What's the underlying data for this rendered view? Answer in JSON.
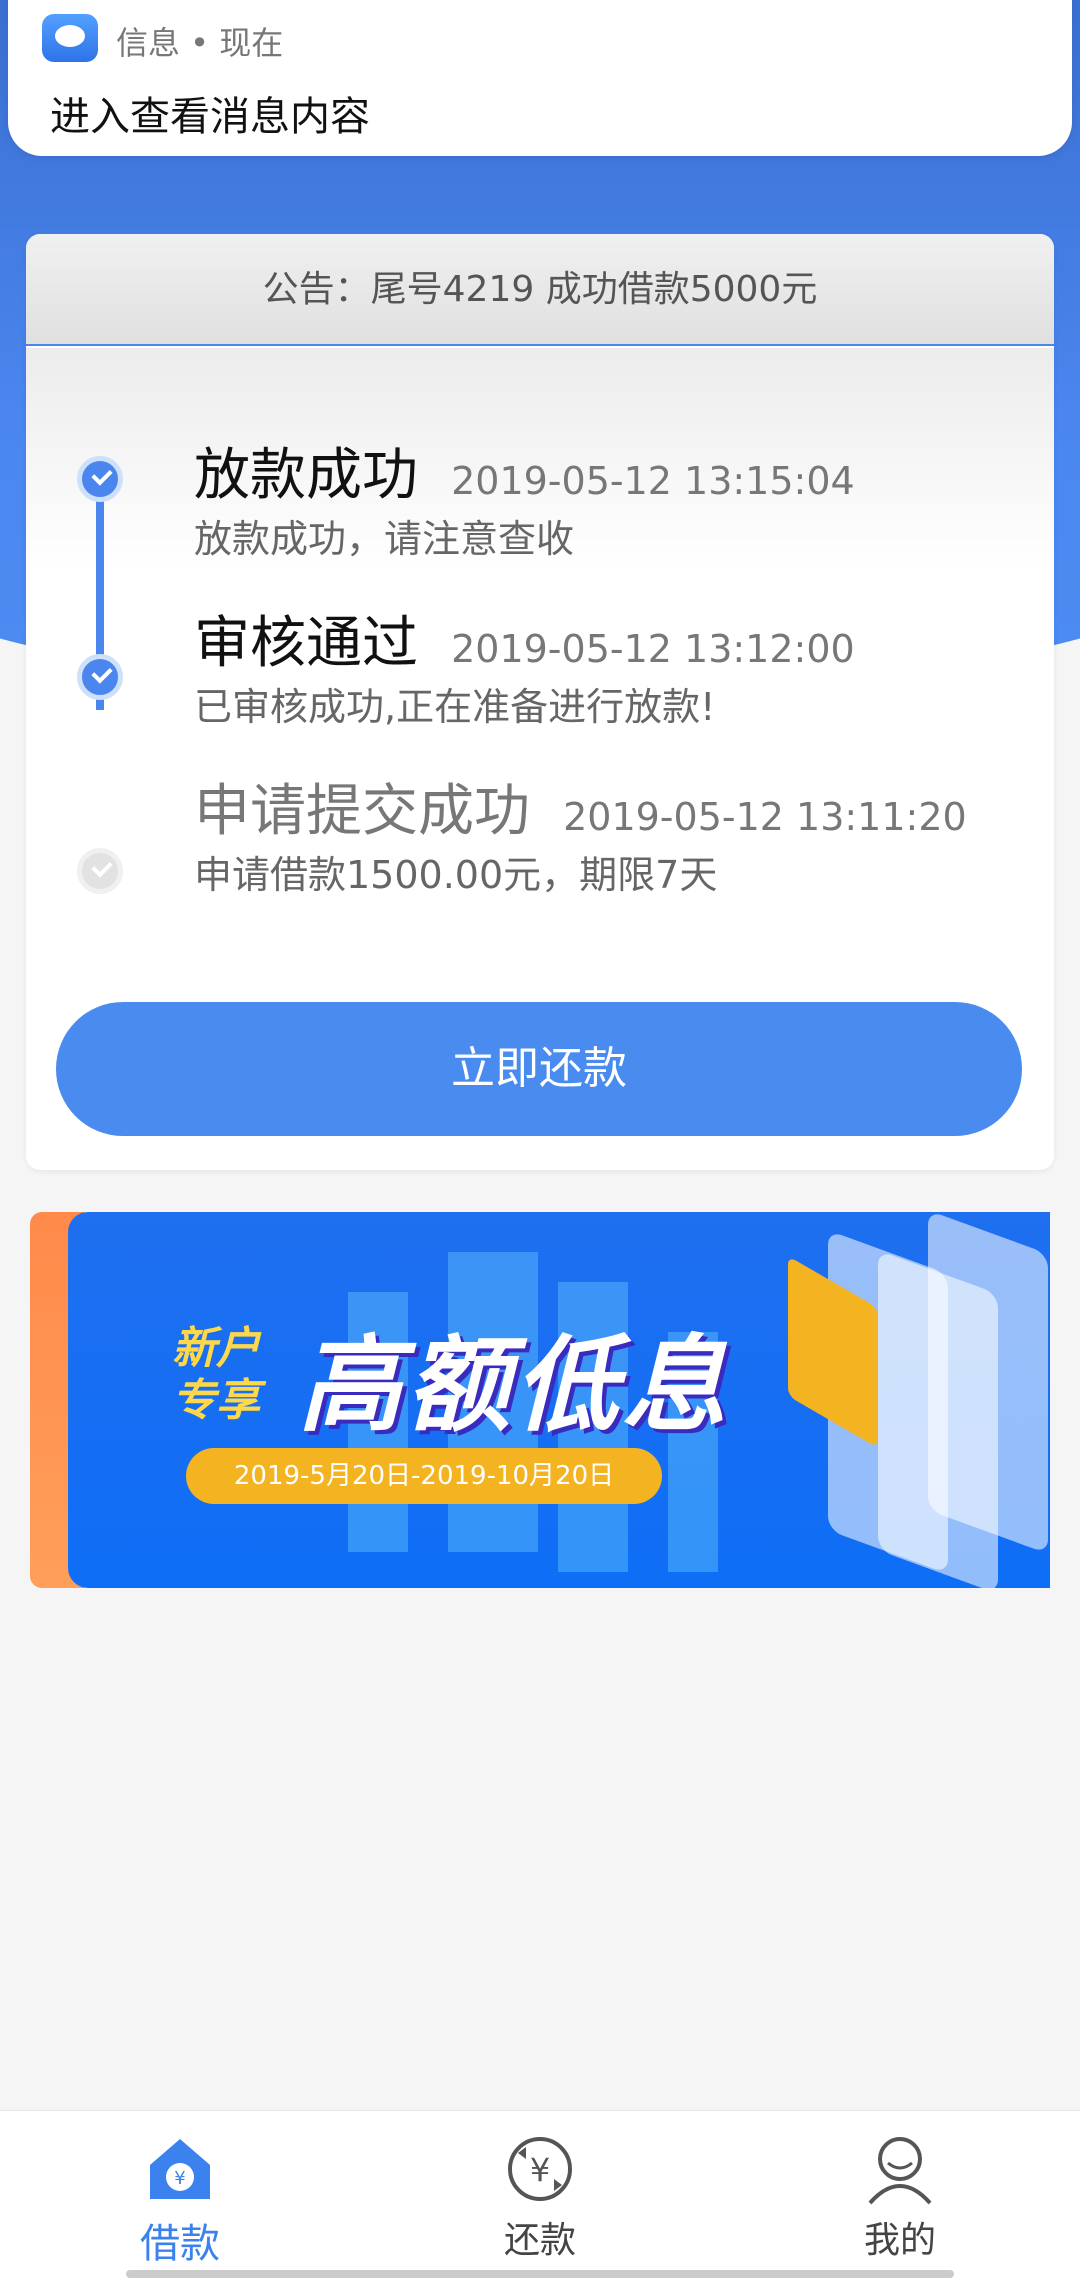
{
  "notification": {
    "app": "信息 • 现在",
    "message": "进入查看消息内容"
  },
  "announcement": "公告：尾号4219 成功借款5000元",
  "timeline": [
    {
      "title": "放款成功",
      "time": "2019-05-12 13:15:04",
      "desc": "放款成功，请注意查收",
      "done": true
    },
    {
      "title": "审核通过",
      "time": "2019-05-12 13:12:00",
      "desc": "已审核成功,正在准备进行放款!",
      "done": true
    },
    {
      "title": "申请提交成功",
      "time": "2019-05-12 13:11:20",
      "desc": "申请借款1500.00元，期限7天",
      "done": false
    }
  ],
  "repay_button": "立即还款",
  "banner": {
    "tag_line1": "新户",
    "tag_line2": "专享",
    "headline": "高额低息",
    "date_range": "2019-5月20日-2019-10月20日"
  },
  "bottom_nav": [
    {
      "label": "借款",
      "icon": "home-yen-icon",
      "active": true
    },
    {
      "label": "还款",
      "icon": "repay-yen-icon",
      "active": false
    },
    {
      "label": "我的",
      "icon": "user-icon",
      "active": false
    }
  ],
  "colors": {
    "primary": "#4a86ee",
    "button": "#4a8bf0",
    "date_pill": "#f4b320",
    "banner_bg": "#1f6ff0"
  }
}
